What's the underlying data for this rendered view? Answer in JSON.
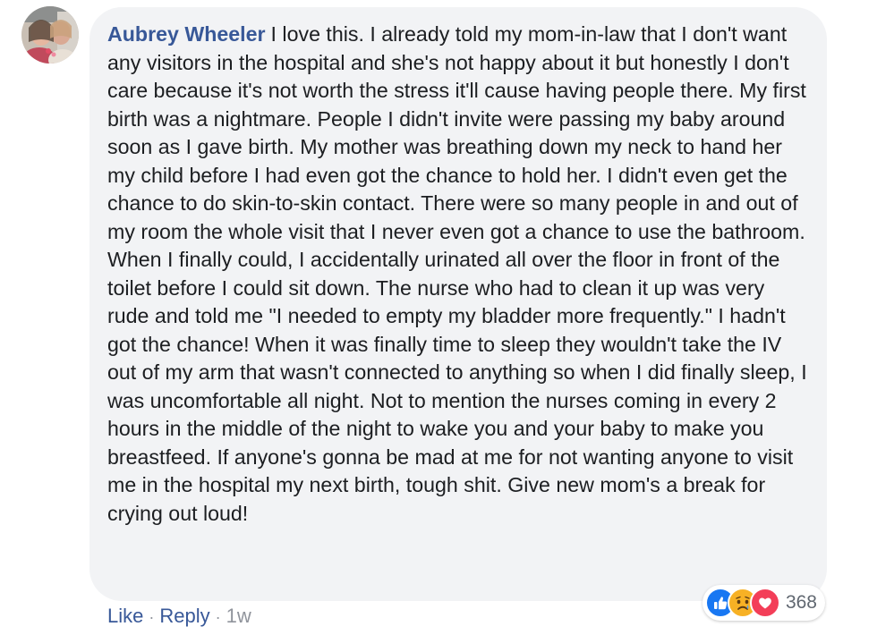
{
  "comment": {
    "author": "Aubrey Wheeler",
    "text": "I love this. I already told my mom-in-law that I don't want any visitors in the hospital and she's not happy about it but honestly I don't care because it's not worth the stress it'll cause having people there. My first birth was a nightmare. People I didn't invite were passing my baby around soon as I gave birth. My mother was breathing down my neck to hand her my child before I had even got the chance to hold her. I didn't even get the chance to do skin-to-skin contact. There were so many people in and out of my room the whole visit that I never even got a chance to use the bathroom. When I finally could, I accidentally urinated all over the floor in front of the toilet before I could sit down. The nurse who had to clean it up was very rude and told me \"I needed to empty my bladder more frequently.\" I hadn't got the chance! When it was finally time to sleep they wouldn't take the IV out of my arm that wasn't connected to anything so when I did finally sleep, I was uncomfortable all night. Not to mention the nurses coming in every 2 hours in the middle of the night to wake you and your baby to make you breastfeed. If anyone's gonna be mad at me for not wanting anyone to visit me in the hospital my next birth, tough shit. Give new mom's a break for crying out loud!"
  },
  "actions": {
    "like_label": "Like",
    "reply_label": "Reply",
    "separator": "·",
    "timestamp": "1w"
  },
  "reactions": {
    "icons": [
      "like-icon",
      "sad-icon",
      "love-icon"
    ],
    "count": "368"
  },
  "colors": {
    "bubble_background": "#f2f3f5",
    "author_link": "#385898",
    "body_text": "#1c1e21",
    "secondary_text": "#90949c",
    "like_blue": "#1877f2",
    "love_red": "#f33e58",
    "sad_yellow": "#f7b125"
  }
}
